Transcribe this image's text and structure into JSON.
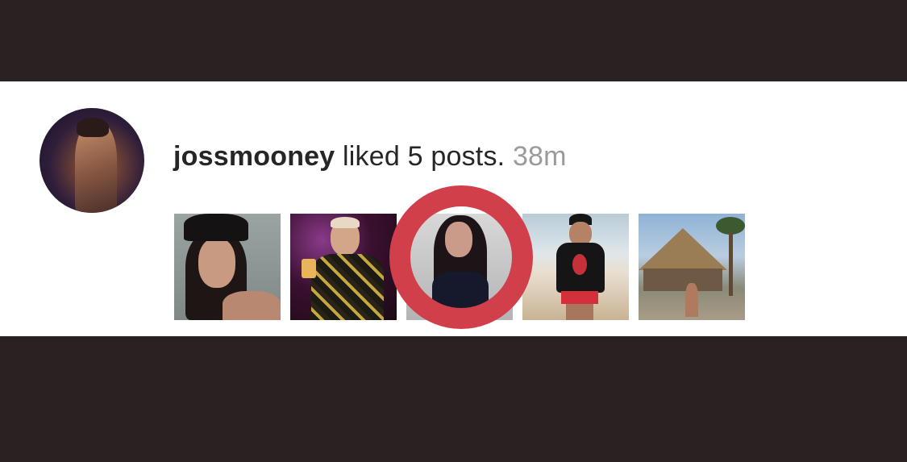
{
  "notification": {
    "username": "jossmooney",
    "action_text": "liked 5 posts.",
    "timestamp": "38m",
    "avatar": "profile-photo",
    "posts": [
      {
        "thumbnail": "woman-selfie-beanie"
      },
      {
        "thumbnail": "man-holding-drink"
      },
      {
        "thumbnail": "woman-lace-top"
      },
      {
        "thumbnail": "man-on-beach"
      },
      {
        "thumbnail": "man-at-thatched-hut"
      }
    ]
  },
  "colors": {
    "background_band": "#2a2222",
    "row_background": "#ffffff",
    "text": "#262626",
    "timestamp": "#9a9a9a",
    "highlight_ring": "#d1404a"
  }
}
